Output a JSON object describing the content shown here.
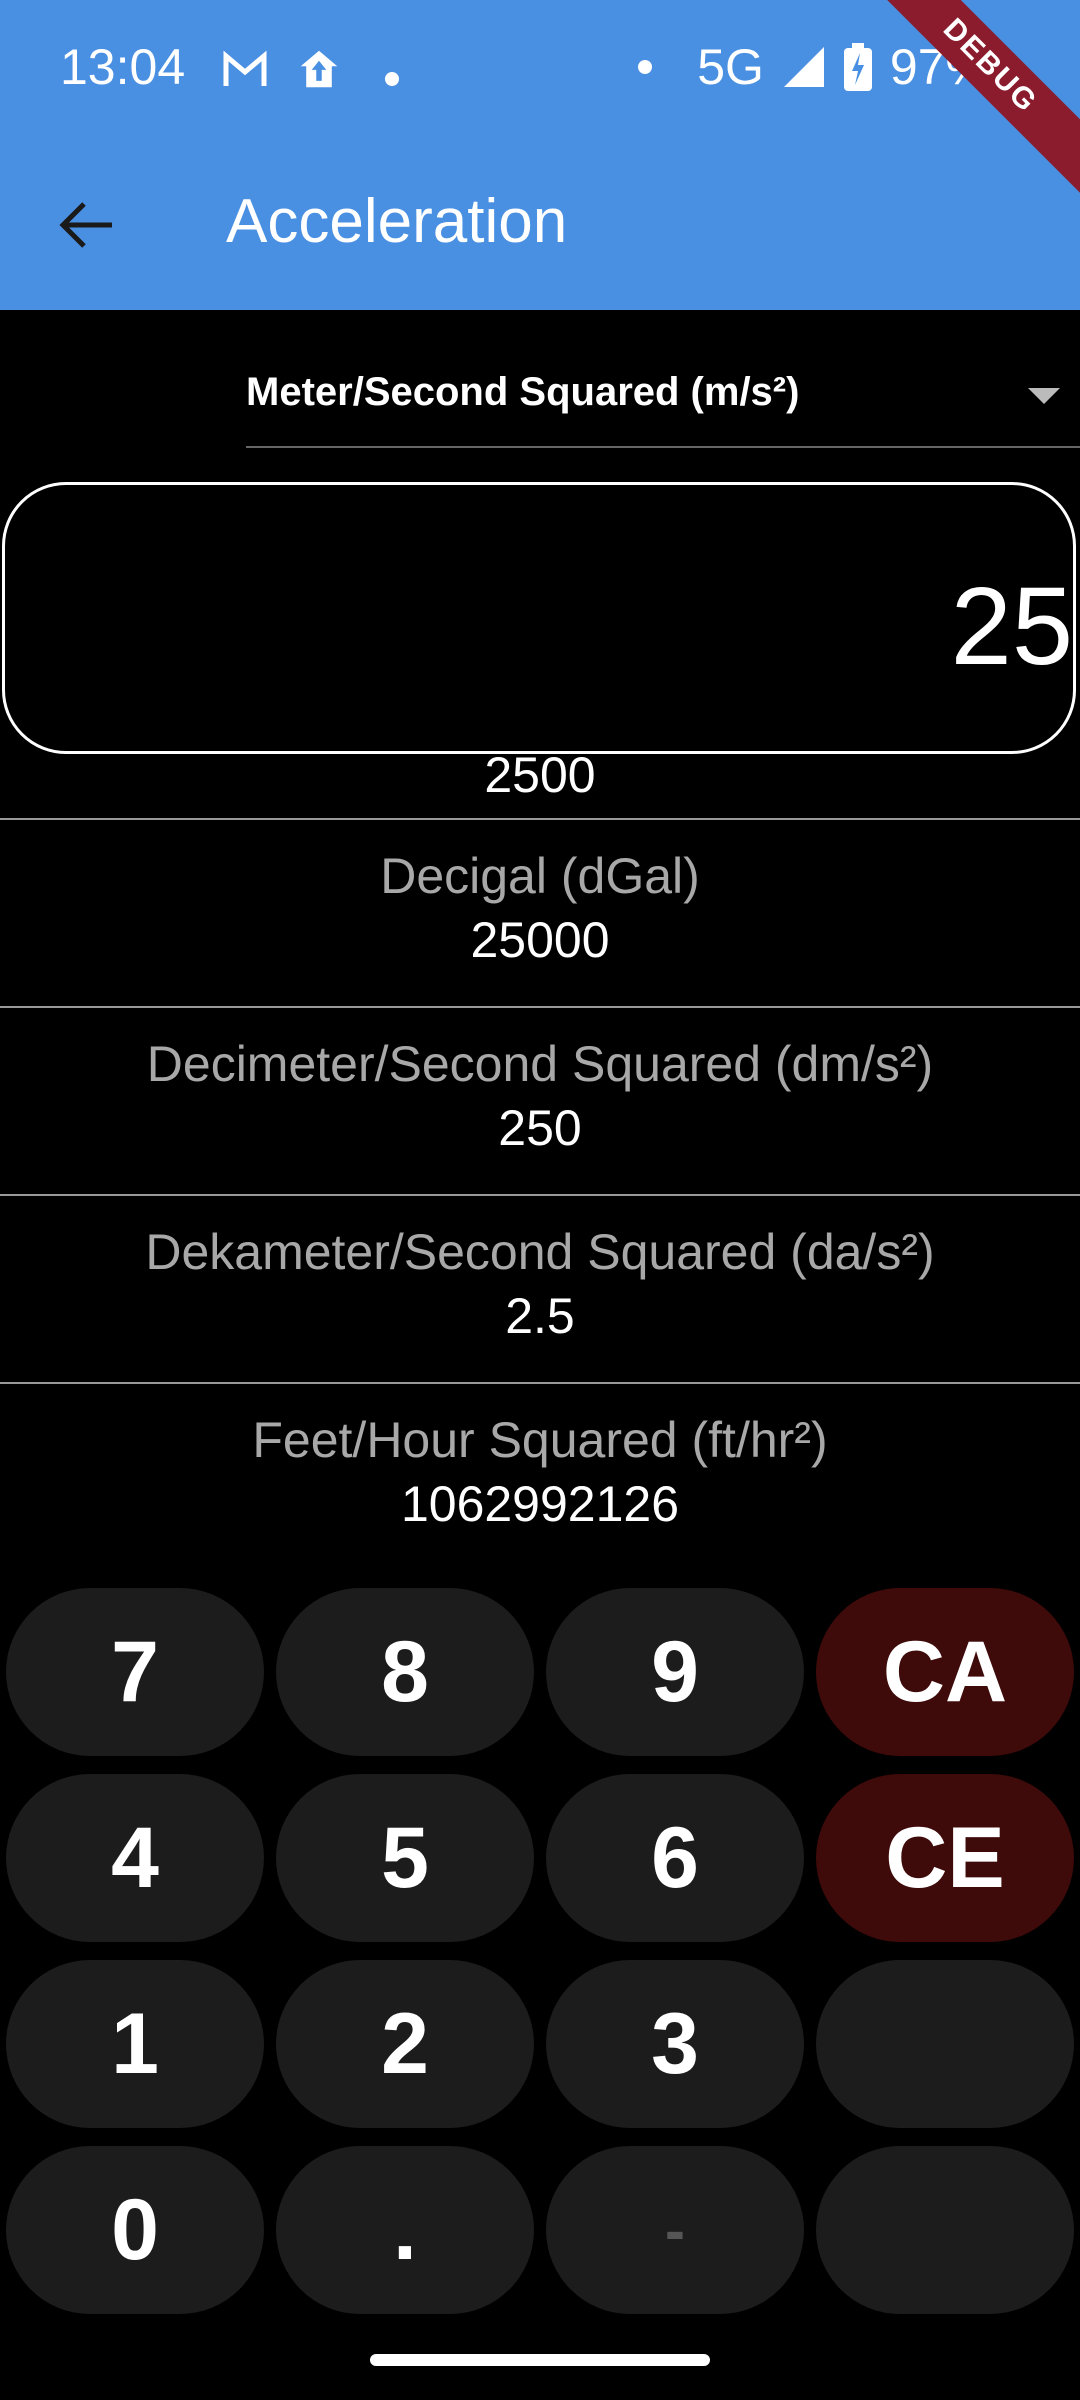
{
  "status_bar": {
    "time": "13:04",
    "network": "5G",
    "battery": "97%",
    "debug": "DEBUG"
  },
  "app_bar": {
    "title": "Acceleration"
  },
  "unit_select": {
    "value": "Meter/Second Squared (m/s²)"
  },
  "input": {
    "value": "25"
  },
  "results": [
    {
      "label": "",
      "value": "2500"
    },
    {
      "label": "Decigal (dGal)",
      "value": "25000"
    },
    {
      "label": "Decimeter/Second Squared (dm/s²)",
      "value": "250"
    },
    {
      "label": "Dekameter/Second Squared (da/s²)",
      "value": "2.5"
    },
    {
      "label": "Feet/Hour Squared (ft/hr²)",
      "value": "1062992126"
    }
  ],
  "keypad": {
    "k7": "7",
    "k8": "8",
    "k9": "9",
    "ca": "CA",
    "k4": "4",
    "k5": "5",
    "k6": "6",
    "ce": "CE",
    "k1": "1",
    "k2": "2",
    "k3": "3",
    "blank1": "",
    "k0": "0",
    "dot": ".",
    "minus": "-",
    "blank2": ""
  }
}
